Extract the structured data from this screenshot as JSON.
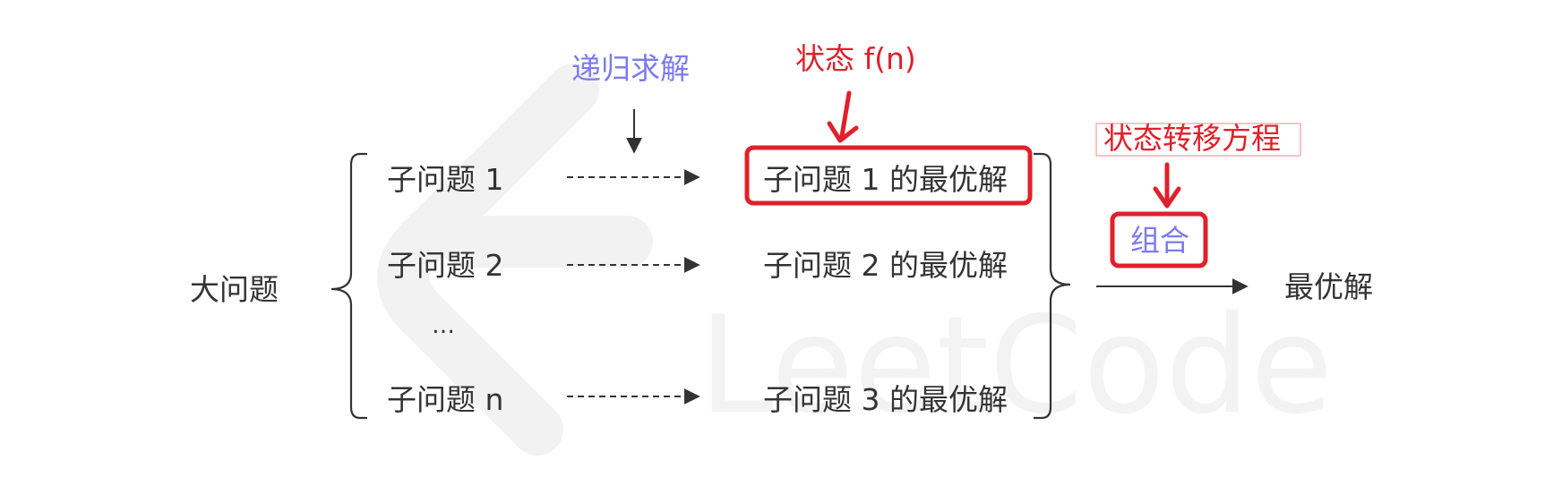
{
  "big_problem": "大问题",
  "subproblems": [
    "子问题 1",
    "子问题 2",
    "…",
    "子问题 n"
  ],
  "optimal_solutions": [
    "子问题 1 的最优解",
    "子问题 2 的最优解",
    "子问题 3 的最优解"
  ],
  "final_result": "最优解",
  "annotations": {
    "recursive_solve": "递归求解",
    "state": "状态 f(n)",
    "transition_equation": "状态转移方程",
    "combine": "组合"
  },
  "watermark": "LeetCode",
  "colors": {
    "text": "#333333",
    "blue_label": "#7b7bf0",
    "red_annotation": "#e0202b",
    "watermark": "#f2f2f2"
  }
}
